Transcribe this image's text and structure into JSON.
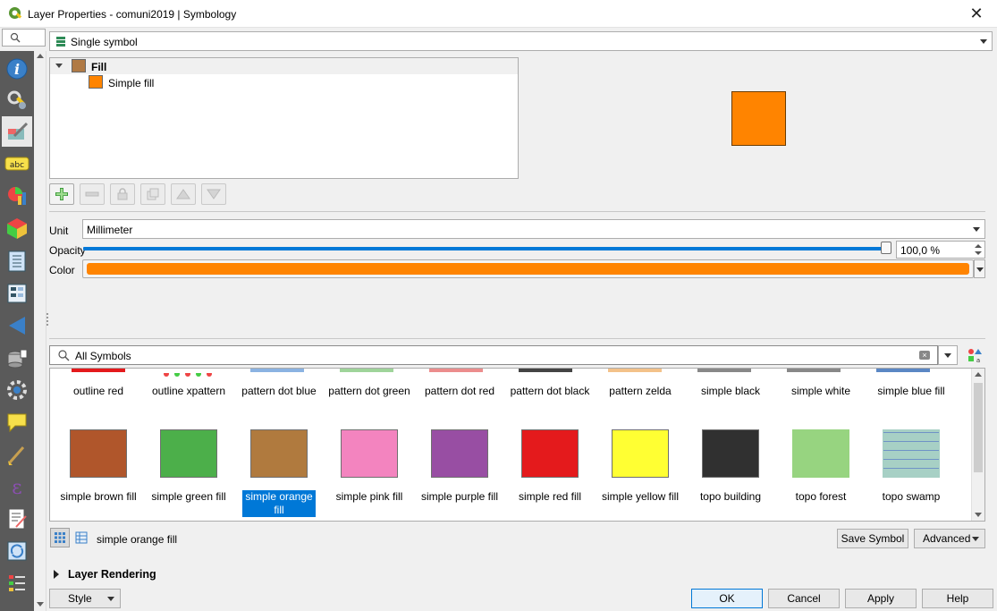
{
  "window": {
    "title": "Layer Properties - comuni2019 | Symbology",
    "close": "✕"
  },
  "nav": {
    "items": [
      "information-icon",
      "source-icon",
      "symbology-icon",
      "labels-icon",
      "diagrams-icon",
      "3d-view-icon",
      "fields-icon",
      "attributes-form-icon",
      "joins-icon",
      "auxiliary-storage-icon",
      "actions-icon",
      "display-icon",
      "rendering-icon",
      "variables-icon",
      "metadata-icon",
      "dependencies-icon",
      "legend-icon"
    ]
  },
  "renderer": {
    "selected": "Single symbol"
  },
  "tree": {
    "root": "Fill",
    "child": "Simple fill",
    "root_color": "#b07a45",
    "child_color": "#ff8400"
  },
  "props": {
    "unit_label": "Unit",
    "unit_value": "Millimeter",
    "opacity_label": "Opacity",
    "opacity_value": "100,0 %",
    "opacity_fraction": 1.0,
    "color_label": "Color",
    "color_value": "#ff8400"
  },
  "symbols": {
    "search_value": "All Symbols",
    "row1": [
      {
        "label": "outline red"
      },
      {
        "label": "outline xpattern"
      },
      {
        "label": "pattern dot  blue"
      },
      {
        "label": "pattern dot green"
      },
      {
        "label": "pattern dot  red"
      },
      {
        "label": "pattern dot black"
      },
      {
        "label": "pattern zelda"
      },
      {
        "label": "simple  black"
      },
      {
        "label": "simple  white"
      },
      {
        "label": "simple blue fill"
      }
    ],
    "row2": [
      {
        "label": "simple brown fill",
        "color": "#b0562b"
      },
      {
        "label": "simple green fill",
        "color": "#4caf4a"
      },
      {
        "label": "simple orange fill",
        "color": "#b07a3e"
      },
      {
        "label": "simple pink fill",
        "color": "#f384bf"
      },
      {
        "label": "simple purple fill",
        "color": "#984ea3"
      },
      {
        "label": "simple red fill",
        "color": "#e41a1c"
      },
      {
        "label": "simple yellow fill",
        "color": "#ffff33"
      },
      {
        "label": "topo building",
        "color": "#303030"
      },
      {
        "label": "topo forest",
        "color": "#97d480"
      },
      {
        "label": "topo swamp",
        "color": "#a7d0c5"
      }
    ],
    "selected_name": "simple orange fill"
  },
  "buttons": {
    "save_symbol": "Save Symbol",
    "advanced": "Advanced",
    "style": "Style",
    "ok": "OK",
    "cancel": "Cancel",
    "apply": "Apply",
    "help": "Help"
  },
  "sections": {
    "layer_rendering": "Layer Rendering"
  }
}
